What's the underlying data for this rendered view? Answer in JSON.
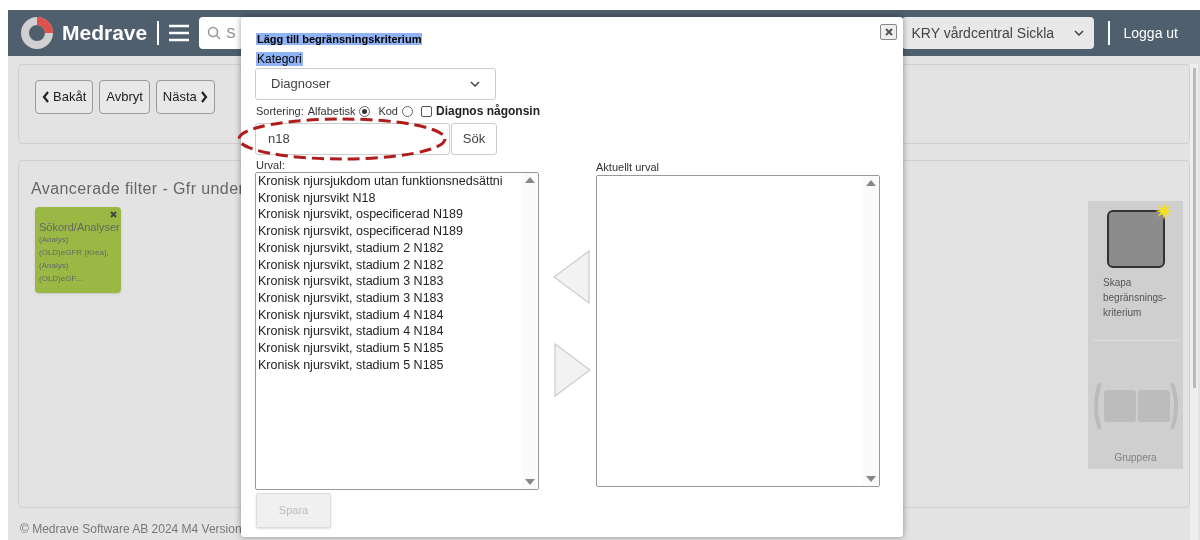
{
  "header": {
    "logo": "Medrave",
    "search": {
      "placeholder": "S"
    },
    "clinic_select": "KRY vårdcentral Sickla",
    "logout": "Logga ut"
  },
  "toolbar": [
    {
      "label": "Bakåt",
      "kind": "back"
    },
    {
      "label": "Avbryt",
      "kind": "plain"
    },
    {
      "label": "Nästa",
      "kind": "next"
    }
  ],
  "filter_panel": {
    "title": "Avancerade filter - Gfr under",
    "tiles": [
      {
        "title": "Sökord/Analyser",
        "lines": [
          "(Analys)",
          "(OLD)eGFR (Krea),",
          "(Analys)",
          "(OLD)eGF..."
        ]
      }
    ],
    "create_label": "Skapa begränsnings-kriterium",
    "group_label": "Gruppera"
  },
  "footer": "© Medrave Software AB 2024 M4 Version",
  "dialog": {
    "title": "Lägg till begränsningskriterium",
    "category_label": "Kategori",
    "category_select": "Diagnoser",
    "sort_label": "Sortering:",
    "sort_options": [
      {
        "label": "Alfabetisk",
        "selected": true
      },
      {
        "label": "Kod",
        "selected": false
      }
    ],
    "any_time": {
      "label": "Diagnos någonsin",
      "checked": false
    },
    "search": {
      "value": "n18"
    },
    "search_button": "Sök",
    "results_label": "Urval:",
    "results": [
      "Kronisk njursjukdom utan funktionsnedsättni",
      "Kronisk njursvikt N18",
      "Kronisk njursvikt, ospecificerad N189",
      "Kronisk njursvikt, ospecificerad N189",
      "Kronisk njursvikt, stadium 2 N182",
      "Kronisk njursvikt, stadium 2 N182",
      "Kronisk njursvikt, stadium 3 N183",
      "Kronisk njursvikt, stadium 3 N183",
      "Kronisk njursvikt, stadium 4 N184",
      "Kronisk njursvikt, stadium 4 N184",
      "Kronisk njursvikt, stadium 5 N185",
      "Kronisk njursvikt, stadium 5 N185"
    ],
    "current_label": "Aktuellt urval",
    "save_button": {
      "label": "Spara",
      "disabled": true
    }
  }
}
